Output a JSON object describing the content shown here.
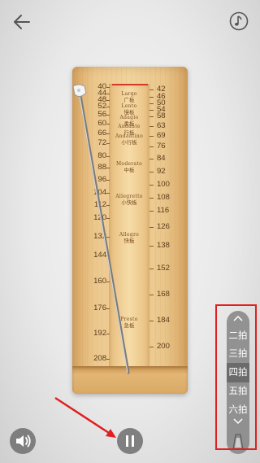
{
  "header": {
    "back_icon": "back-arrow-icon",
    "music_icon": "music-note-icon"
  },
  "scale": {
    "left_ticks": [
      "40",
      "44",
      "48",
      "52",
      "56",
      "60",
      "66",
      "72",
      "80",
      "88",
      "96",
      "104",
      "112",
      "120",
      "132",
      "144",
      "160",
      "176",
      "192",
      "208"
    ],
    "right_ticks": [
      "42",
      "46",
      "50",
      "54",
      "58",
      "63",
      "69",
      "76",
      "84",
      "92",
      "100",
      "108",
      "116",
      "126",
      "138",
      "152",
      "168",
      "184",
      "200"
    ]
  },
  "tempos": [
    {
      "en": "Largo",
      "cn": "广板"
    },
    {
      "en": "Lento",
      "cn": "慢板"
    },
    {
      "en": "Adagio",
      "cn": "柔板"
    },
    {
      "en": "Andante",
      "cn": "行板"
    },
    {
      "en": "Andantino",
      "cn": "小行板"
    },
    {
      "en": "Moderato",
      "cn": "中板"
    },
    {
      "en": "Allegretto",
      "cn": "小快板"
    },
    {
      "en": "Allegro",
      "cn": "快板"
    },
    {
      "en": "Presto",
      "cn": "急板"
    }
  ],
  "controls": {
    "speaker_icon": "speaker-icon",
    "pause_icon": "pause-icon"
  },
  "beat_selector": {
    "up_icon": "chevron-up-icon",
    "down_icon": "chevron-down-icon",
    "items": [
      "二拍",
      "三拍",
      "四拍",
      "五拍",
      "六拍"
    ],
    "selected": "四拍"
  },
  "colors": {
    "highlight": "#e02020",
    "arrow": "#e02020",
    "marker": "#d43a2a"
  }
}
